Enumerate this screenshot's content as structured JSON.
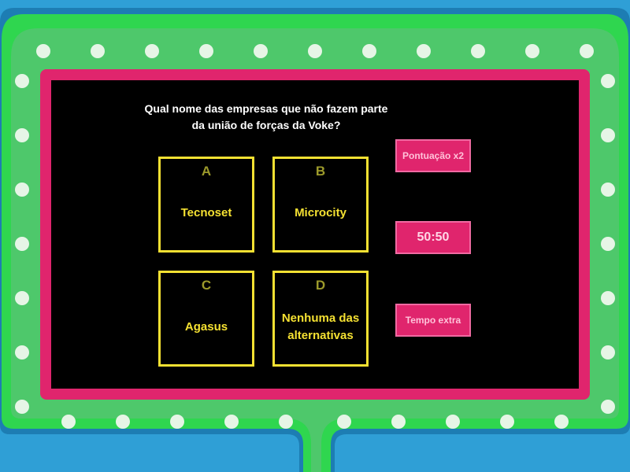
{
  "question": "Qual nome das empresas que não fazem parte da união de forças da Voke?",
  "answers": [
    {
      "letter": "A",
      "text": "Tecnoset"
    },
    {
      "letter": "B",
      "text": "Microcity"
    },
    {
      "letter": "C",
      "text": "Agasus"
    },
    {
      "letter": "D",
      "text": "Nenhuma das alternativas"
    }
  ],
  "powerups": {
    "double_score": "Pontuação x2",
    "fifty_fifty": "50:50",
    "extra_time": "Tempo extra"
  },
  "colors": {
    "background": "#2f9fd6",
    "frame_outer": "#2fd64f",
    "frame_inner": "#4ec86b",
    "bulbs": "#e6f5e6",
    "screen_border": "#e0256d",
    "screen": "#000000",
    "answer_border": "#f5e132",
    "answer_letter": "#9c9a2b",
    "powerup": "#e0256d"
  }
}
